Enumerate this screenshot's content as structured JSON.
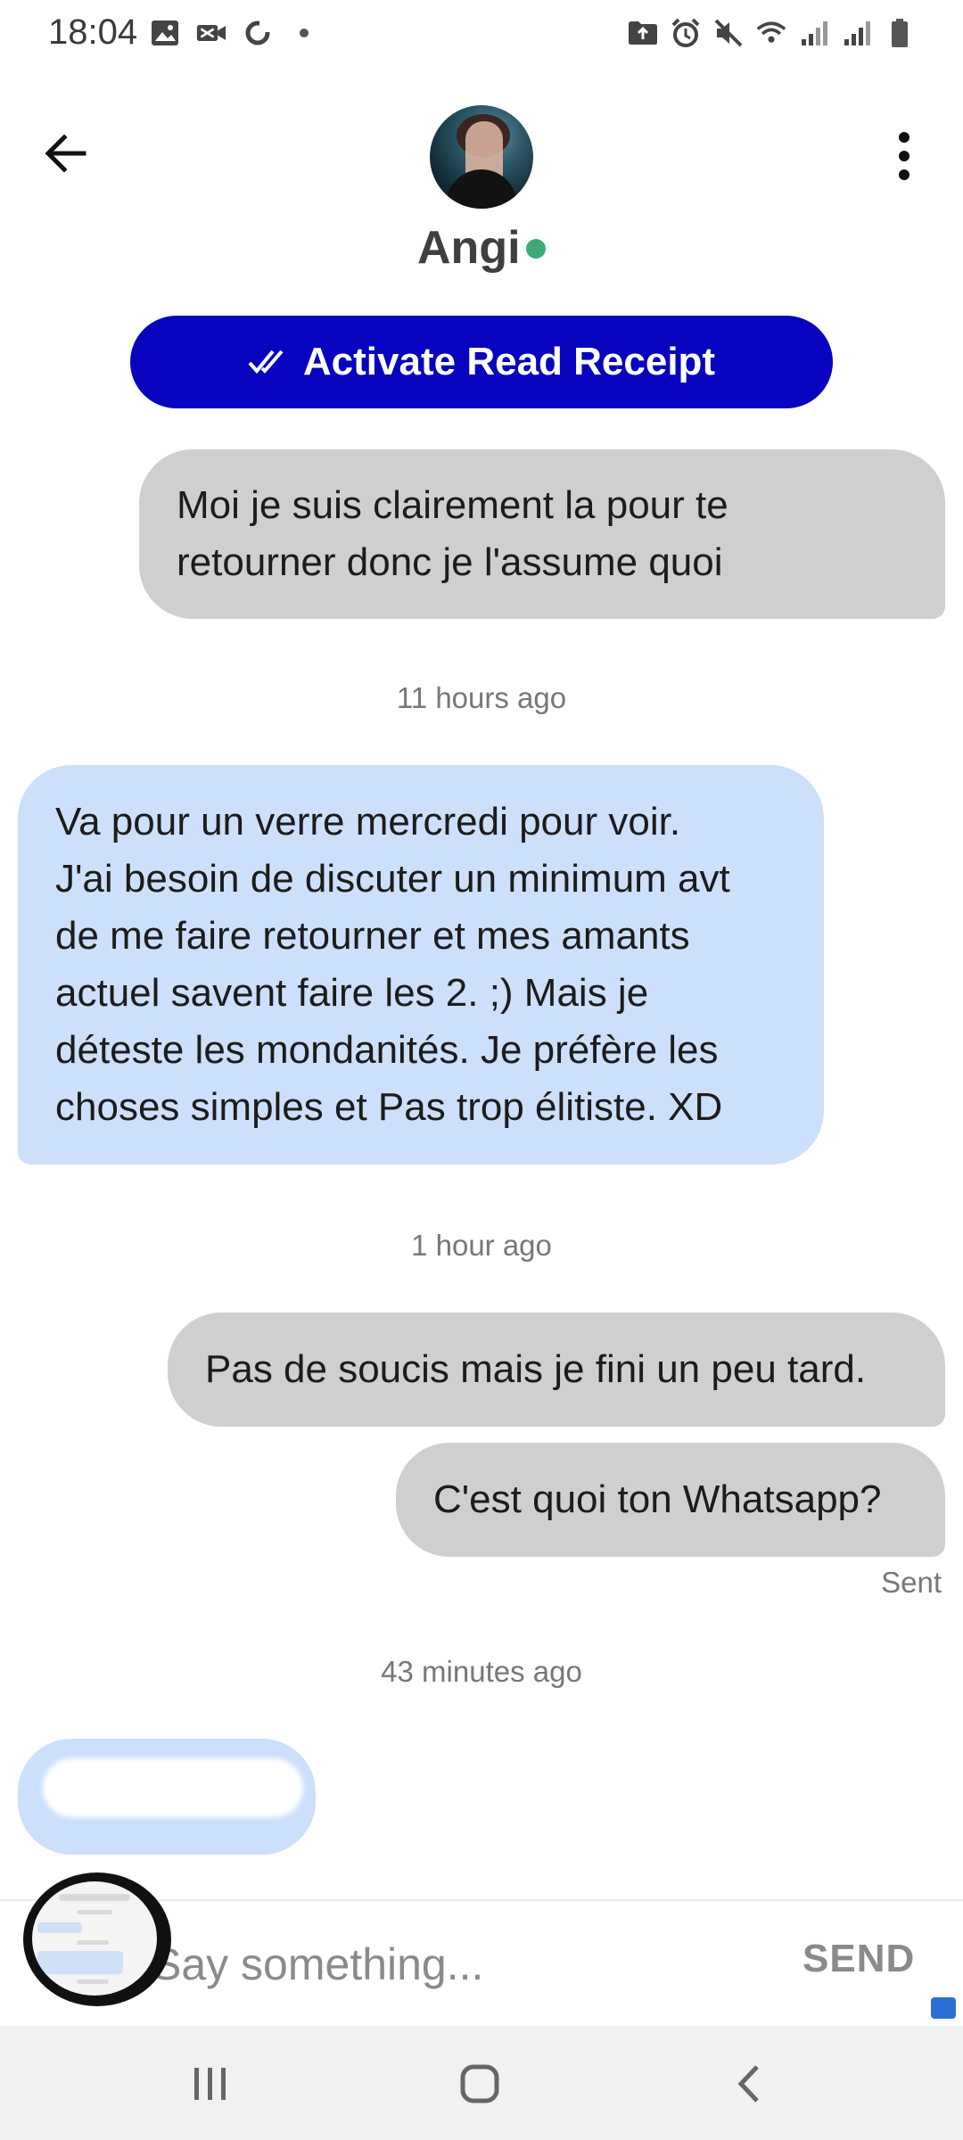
{
  "status_bar": {
    "time": "18:04",
    "left_icons": [
      "image-icon",
      "video-icon",
      "sync-icon",
      "dot-icon"
    ],
    "right_icons": [
      "folder-icon",
      "alarm-icon",
      "mute-icon",
      "wifi-icon",
      "signal-icon",
      "signal-r-icon",
      "battery-icon"
    ]
  },
  "header": {
    "contact_name": "Angi",
    "online": true,
    "online_color": "#3eaa78",
    "read_receipt_label": "Activate Read Receipt",
    "read_receipt_color": "#0703be"
  },
  "messages": [
    {
      "direction": "outgoing",
      "text": "Moi je suis clairement la pour te\nretourner donc je l'assume quoi"
    },
    {
      "type": "timestamp",
      "text": "11 hours ago"
    },
    {
      "direction": "incoming",
      "text": "Va pour un verre mercredi pour voir.\nJ'ai besoin de discuter un minimum avt\nde me faire retourner et mes amants\nactuel savent faire les 2. ;) Mais je\ndéteste les mondanités. Je préfère les\nchoses simples et Pas trop élitiste. XD"
    },
    {
      "type": "timestamp",
      "text": "1 hour ago"
    },
    {
      "direction": "outgoing",
      "text": "Pas de soucis mais je fini un peu tard."
    },
    {
      "direction": "outgoing",
      "text": "C'est quoi ton Whatsapp?",
      "status": "Sent"
    },
    {
      "type": "timestamp",
      "text": "43 minutes ago"
    },
    {
      "direction": "incoming",
      "text": "[redacted]"
    }
  ],
  "composer": {
    "placeholder": "Say something...",
    "send_label": "SEND"
  },
  "colors": {
    "outgoing_bubble": "#cfcfcf",
    "incoming_bubble": "#cce0fc"
  }
}
